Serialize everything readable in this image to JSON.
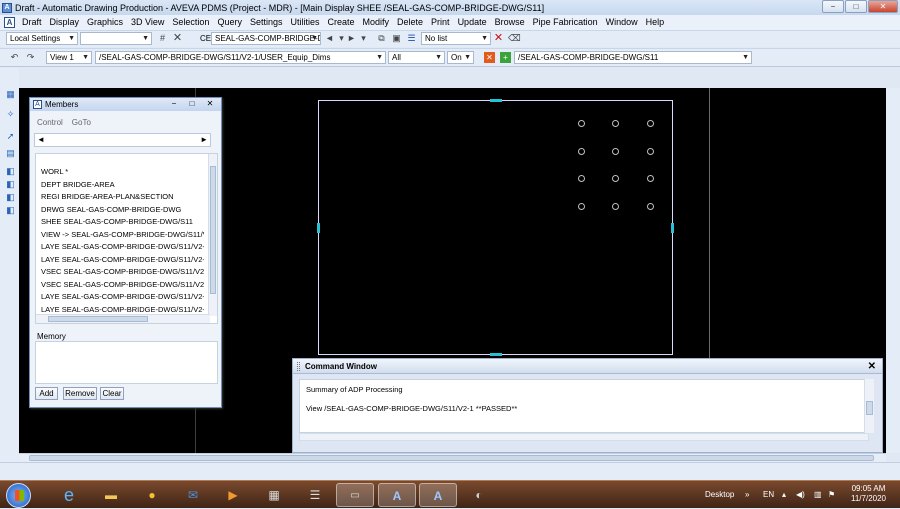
{
  "app": {
    "title": "Draft - Automatic Drawing Production -  AVEVA PDMS (Project - MDR) - [Main Display  SHEE  /SEAL-GAS-COMP-BRIDGE-DWG/S11]",
    "window_buttons": {
      "minimize": "−",
      "maximize": "□",
      "close": "✕"
    }
  },
  "menubar": {
    "items": [
      "Draft",
      "Display",
      "Graphics",
      "3D View",
      "Selection",
      "Query",
      "Settings",
      "Utilities",
      "Create",
      "Modify",
      "Delete",
      "Print",
      "Update",
      "Browse",
      "Pipe Fabrication",
      "Window",
      "Help"
    ]
  },
  "toolbar1": {
    "settings_combo": "Local Settings",
    "empty_combo": "",
    "ce_label": "CE",
    "ce_combo": "SEAL-GAS-COMP-BRIDGE-D",
    "list_combo": "No list"
  },
  "toolbar2": {
    "view_combo": "View 1",
    "path_combo": "/SEAL-GAS-COMP-BRIDGE-DWG/S11/V2-1/USER_Equip_Dims",
    "all_combo": "All",
    "on_combo": "On",
    "sheet_combo": "/SEAL-GAS-COMP-BRIDGE-DWG/S11"
  },
  "members": {
    "title": "Members",
    "menu": {
      "control": "Control",
      "goto": "GoTo"
    },
    "rows": [
      "WORL   *",
      "DEPT   BRIDGE-AREA",
      "REGI   BRIDGE-AREA-PLAN&SECTION",
      "DRWG   SEAL-GAS-COMP-BRIDGE-DWG",
      "SHEE   SEAL-GAS-COMP-BRIDGE-DWG/S11",
      "VIEW -> SEAL-GAS-COMP-BRIDGE-DWG/S11/V2",
      "LAYE   SEAL-GAS-COMP-BRIDGE-DWG/S11/V2-",
      "LAYE   SEAL-GAS-COMP-BRIDGE-DWG/S11/V2-",
      "VSEC   SEAL-GAS-COMP-BRIDGE-DWG/S11/V2-",
      "VSEC   SEAL-GAS-COMP-BRIDGE-DWG/S11/V2-",
      "LAYE   SEAL-GAS-COMP-BRIDGE-DWG/S11/V2-",
      "LAYE   SEAL-GAS-COMP-BRIDGE-DWG/S11/V2-"
    ],
    "memory_label": "Memory",
    "buttons": {
      "add": "Add",
      "remove": "Remove",
      "clear": "Clear"
    }
  },
  "command_window": {
    "title": "Command Window",
    "lines": [
      "Summary of ADP Processing",
      "View /SEAL-GAS-COMP-BRIDGE-DWG/S11/V2-1 **PASSED**"
    ]
  },
  "taskbar": {
    "desktop": "Desktop",
    "language": "EN",
    "time": "09:05 AM",
    "date": "11/7/2020"
  },
  "colors": {
    "canvas": "#000000",
    "sheet_border": "#d9d9ff",
    "marker": "#27c2d8",
    "taskbar": "#5a341f"
  }
}
